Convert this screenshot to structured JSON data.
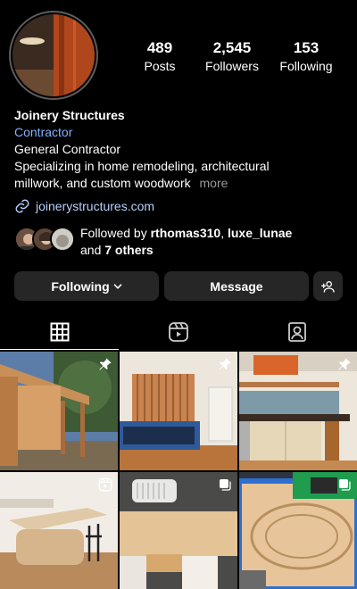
{
  "profile": {
    "stats": [
      {
        "value": "489",
        "label": "Posts"
      },
      {
        "value": "2,545",
        "label": "Followers"
      },
      {
        "value": "153",
        "label": "Following"
      }
    ],
    "name": "Joinery Structures",
    "category": "Contractor",
    "subcategory": "General Contractor",
    "bio_line1": "Specializing in home remodeling, architectural",
    "bio_line2": "millwork, and custom woodwork",
    "more_label": "more",
    "link": "joinerystructures.com"
  },
  "followed_by": {
    "prefix": "Followed by",
    "user1": "rthomas310",
    "separator": ",",
    "user2": "luxe_lunae",
    "and_label": "and",
    "others": "7 others"
  },
  "actions": {
    "following_label": "Following",
    "message_label": "Message"
  },
  "tabs": [
    {
      "icon": "grid-icon",
      "active": true
    },
    {
      "icon": "reels-icon",
      "active": false
    },
    {
      "icon": "tagged-icon",
      "active": false
    }
  ],
  "posts": [
    {
      "badge": "pin-icon"
    },
    {
      "badge": "pin-icon"
    },
    {
      "badge": "pin-icon"
    },
    {
      "badge": "reels-icon"
    },
    {
      "badge": "carousel-icon"
    },
    {
      "badge": "carousel-icon"
    }
  ]
}
